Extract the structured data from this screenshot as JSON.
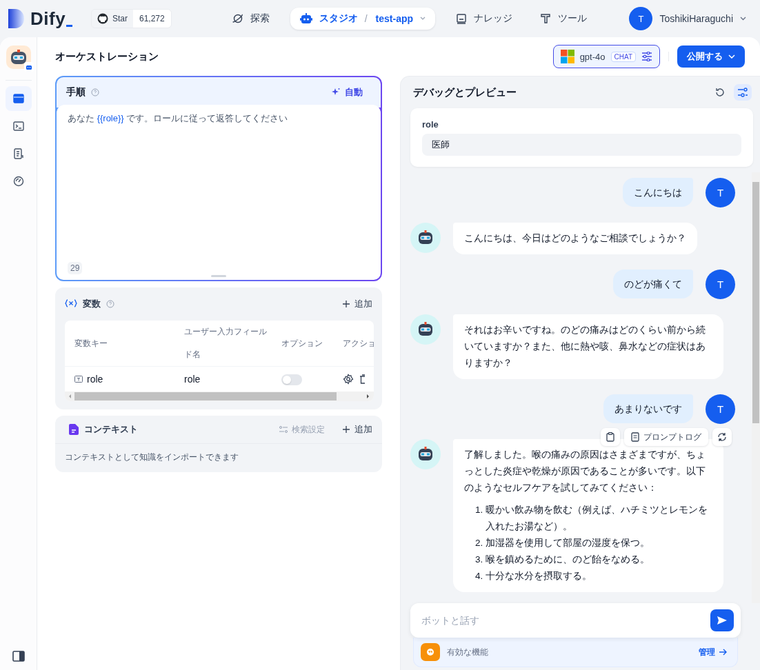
{
  "topbar": {
    "logo": "Dify",
    "github": {
      "label": "Star",
      "count": "61,272"
    },
    "nav": [
      {
        "kind": "explore",
        "label": "探索",
        "selected": false
      },
      {
        "kind": "studio",
        "label": "スタジオ",
        "separator": "/",
        "app": "test-app",
        "selected": true
      },
      {
        "kind": "knowledge",
        "label": "ナレッジ",
        "selected": false
      },
      {
        "kind": "tools",
        "label": "ツール",
        "selected": false
      }
    ],
    "user": {
      "initial": "T",
      "name": "ToshikiHaraguchi"
    }
  },
  "sidebar": {
    "items": [
      {
        "kind": "orchestrate",
        "selected": true
      },
      {
        "kind": "api",
        "selected": false
      },
      {
        "kind": "logs",
        "selected": false
      },
      {
        "kind": "overview",
        "selected": false
      }
    ]
  },
  "page_title": "オーケストレーション",
  "model": {
    "name": "gpt-4o",
    "badge": "CHAT"
  },
  "publish_button": "公開する",
  "instructions": {
    "title": "手順",
    "auto_button": "自動",
    "prompt": [
      {
        "kind": "text",
        "text": "あなた "
      },
      {
        "kind": "variable",
        "text": "{{role}}"
      },
      {
        "kind": "text",
        "text": " です。ロールに従って返答してください"
      }
    ],
    "count": "29"
  },
  "variables": {
    "title": "変数",
    "add_button": "追加",
    "columns": [
      "変数キー",
      "ユーザー入力フィールド名",
      "オプション",
      "アクショ"
    ],
    "rows": [
      {
        "key": "role",
        "name": "role",
        "optional": false
      }
    ]
  },
  "context": {
    "title": "コンテキスト",
    "retrieval_button": "検索設定",
    "retrieval_disabled": true,
    "add_button": "追加",
    "hint": "コンテキストとして知識をインポートできます"
  },
  "debug": {
    "title": "デバッグとプレビュー",
    "inputs": [
      {
        "label": "role",
        "value": "医師"
      }
    ],
    "messages": [
      {
        "kind": "user",
        "text": "こんにちは",
        "avatar": "T"
      },
      {
        "kind": "bot",
        "text": "こんにちは、今日はどのようなご相談でしょうか？"
      },
      {
        "kind": "user",
        "text": "のどが痛くて",
        "avatar": "T"
      },
      {
        "kind": "bot",
        "text": "それはお辛いですね。のどの痛みはどのくらい前から続いていますか？また、他に熱や咳、鼻水などの症状はありますか？"
      },
      {
        "kind": "user",
        "text": "あまりないです",
        "avatar": "T"
      },
      {
        "kind": "bot",
        "text": "了解しました。喉の痛みの原因はさまざまですが、ちょっとした炎症や乾燥が原因であることが多いです。以下のようなセルフケアを試してみてください：",
        "list": [
          {
            "number": "1.",
            "text": "暖かい飲み物を飲む（例えば、ハチミツとレモンを入れたお湯など）。"
          },
          {
            "number": "2.",
            "text": "加湿器を使用して部屋の湿度を保つ。"
          },
          {
            "number": "3.",
            "text": "喉を鎮めるために、のど飴をなめる。"
          },
          {
            "number": "4.",
            "text": "十分な水分を摂取する。"
          }
        ],
        "actions": {
          "log": "プロンプトログ"
        }
      }
    ],
    "chat_input": {
      "placeholder": "ボットと話す"
    },
    "features": {
      "label": "有効な機能",
      "manage": "管理"
    }
  }
}
